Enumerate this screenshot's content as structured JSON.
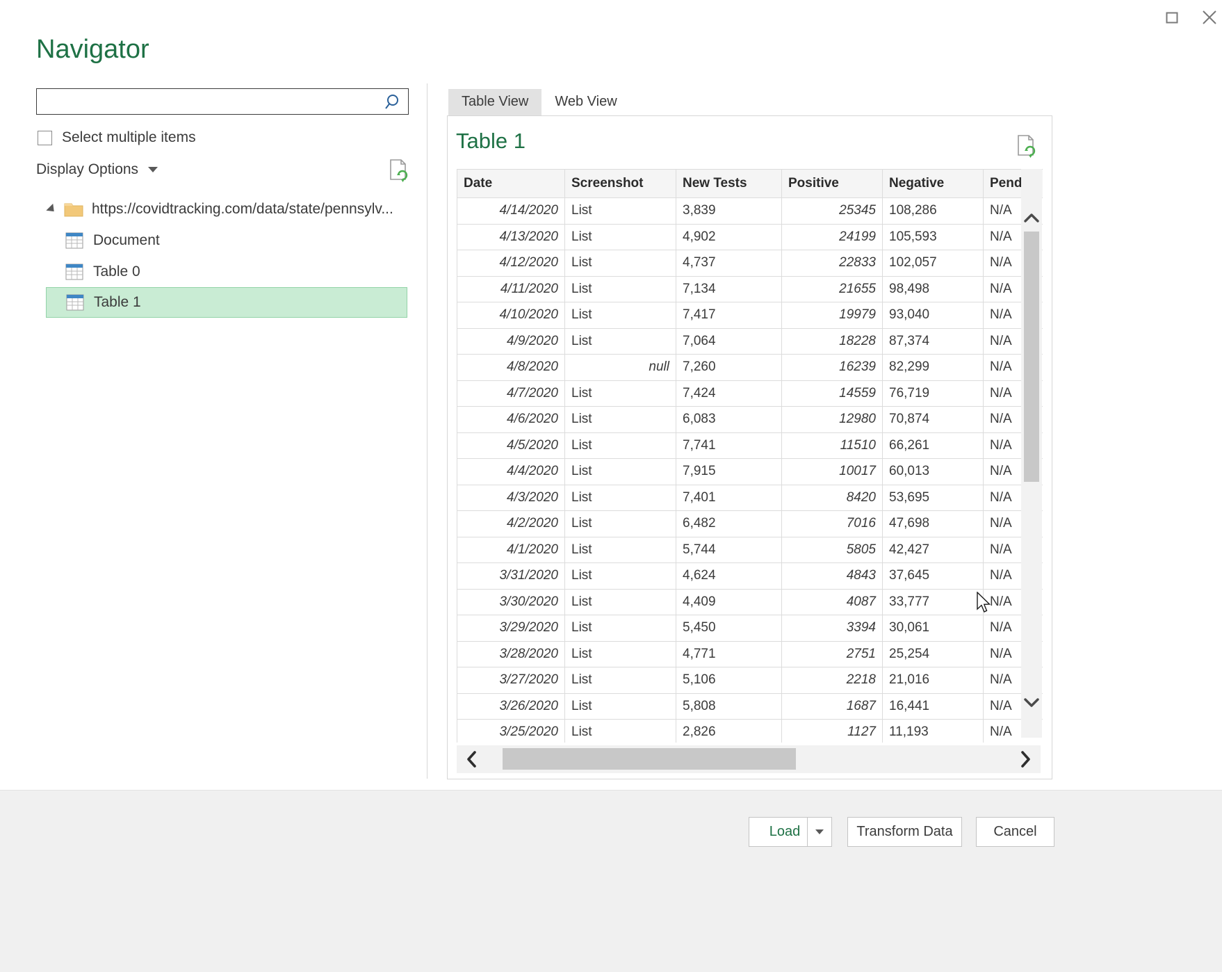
{
  "window": {
    "maximize_label": "Maximize",
    "close_label": "Close"
  },
  "page_title": "Navigator",
  "search": {
    "value": "",
    "placeholder": "",
    "icon": "search-icon"
  },
  "select_multiple": {
    "label": "Select multiple items",
    "checked": false
  },
  "display_options": {
    "label": "Display Options",
    "caret": "chevron-down-icon"
  },
  "refresh_icon_label": "refresh-document-icon",
  "tree": {
    "root": {
      "label": "https://covidtracking.com/data/state/pennsylv...",
      "icon": "folder-icon",
      "expanded": true
    },
    "children": [
      {
        "label": "Document",
        "icon": "table-icon",
        "selected": false
      },
      {
        "label": "Table 0",
        "icon": "table-icon",
        "selected": false
      },
      {
        "label": "Table 1",
        "icon": "table-icon",
        "selected": true
      }
    ]
  },
  "preview": {
    "tabs": [
      {
        "label": "Table View",
        "active": true
      },
      {
        "label": "Web View",
        "active": false
      }
    ],
    "title": "Table 1",
    "columns": [
      "Date",
      "Screenshot",
      "New Tests",
      "Positive",
      "Negative",
      "Pending"
    ],
    "rows": [
      {
        "date": "4/14/2020",
        "screenshot": "List",
        "new_tests": "3,839",
        "positive": "25345",
        "negative": "108,286",
        "pending": "N/A"
      },
      {
        "date": "4/13/2020",
        "screenshot": "List",
        "new_tests": "4,902",
        "positive": "24199",
        "negative": "105,593",
        "pending": "N/A"
      },
      {
        "date": "4/12/2020",
        "screenshot": "List",
        "new_tests": "4,737",
        "positive": "22833",
        "negative": "102,057",
        "pending": "N/A"
      },
      {
        "date": "4/11/2020",
        "screenshot": "List",
        "new_tests": "7,134",
        "positive": "21655",
        "negative": "98,498",
        "pending": "N/A"
      },
      {
        "date": "4/10/2020",
        "screenshot": "List",
        "new_tests": "7,417",
        "positive": "19979",
        "negative": "93,040",
        "pending": "N/A"
      },
      {
        "date": "4/9/2020",
        "screenshot": "List",
        "new_tests": "7,064",
        "positive": "18228",
        "negative": "87,374",
        "pending": "N/A"
      },
      {
        "date": "4/8/2020",
        "screenshot": "null",
        "new_tests": "7,260",
        "positive": "16239",
        "negative": "82,299",
        "pending": "N/A"
      },
      {
        "date": "4/7/2020",
        "screenshot": "List",
        "new_tests": "7,424",
        "positive": "14559",
        "negative": "76,719",
        "pending": "N/A"
      },
      {
        "date": "4/6/2020",
        "screenshot": "List",
        "new_tests": "6,083",
        "positive": "12980",
        "negative": "70,874",
        "pending": "N/A"
      },
      {
        "date": "4/5/2020",
        "screenshot": "List",
        "new_tests": "7,741",
        "positive": "11510",
        "negative": "66,261",
        "pending": "N/A"
      },
      {
        "date": "4/4/2020",
        "screenshot": "List",
        "new_tests": "7,915",
        "positive": "10017",
        "negative": "60,013",
        "pending": "N/A"
      },
      {
        "date": "4/3/2020",
        "screenshot": "List",
        "new_tests": "7,401",
        "positive": "8420",
        "negative": "53,695",
        "pending": "N/A"
      },
      {
        "date": "4/2/2020",
        "screenshot": "List",
        "new_tests": "6,482",
        "positive": "7016",
        "negative": "47,698",
        "pending": "N/A"
      },
      {
        "date": "4/1/2020",
        "screenshot": "List",
        "new_tests": "5,744",
        "positive": "5805",
        "negative": "42,427",
        "pending": "N/A"
      },
      {
        "date": "3/31/2020",
        "screenshot": "List",
        "new_tests": "4,624",
        "positive": "4843",
        "negative": "37,645",
        "pending": "N/A"
      },
      {
        "date": "3/30/2020",
        "screenshot": "List",
        "new_tests": "4,409",
        "positive": "4087",
        "negative": "33,777",
        "pending": "N/A"
      },
      {
        "date": "3/29/2020",
        "screenshot": "List",
        "new_tests": "5,450",
        "positive": "3394",
        "negative": "30,061",
        "pending": "N/A"
      },
      {
        "date": "3/28/2020",
        "screenshot": "List",
        "new_tests": "4,771",
        "positive": "2751",
        "negative": "25,254",
        "pending": "N/A"
      },
      {
        "date": "3/27/2020",
        "screenshot": "List",
        "new_tests": "5,106",
        "positive": "2218",
        "negative": "21,016",
        "pending": "N/A"
      },
      {
        "date": "3/26/2020",
        "screenshot": "List",
        "new_tests": "5,808",
        "positive": "1687",
        "negative": "16,441",
        "pending": "N/A"
      },
      {
        "date": "3/25/2020",
        "screenshot": "List",
        "new_tests": "2,826",
        "positive": "1127",
        "negative": "11,193",
        "pending": "N/A"
      }
    ]
  },
  "footer": {
    "load_label": "Load",
    "load_caret": "chevron-down-icon",
    "transform_label": "Transform Data",
    "cancel_label": "Cancel"
  },
  "colors": {
    "accent_green": "#1e7145",
    "selection_green": "#c9ecd4",
    "footer_gray": "#f0f0f0",
    "header_gray": "#f5f5f5"
  }
}
